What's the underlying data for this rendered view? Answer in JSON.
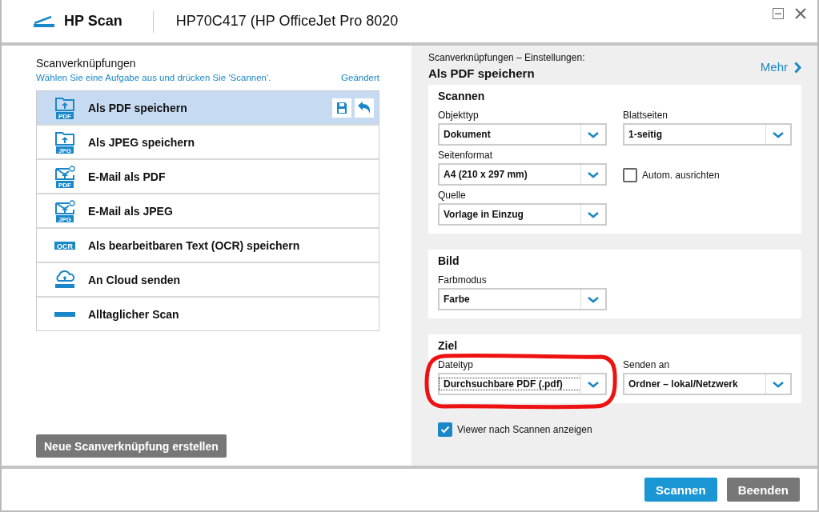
{
  "header": {
    "app_title": "HP Scan",
    "device": "HP70C417 (HP OfficeJet Pro 8020"
  },
  "shortcuts_panel": {
    "title": "Scanverknüpfungen",
    "hint": "Wählen Sie eine Aufgabe aus und drücken Sie 'Scannen'.",
    "changed_link": "Geändert",
    "items": [
      {
        "label": "Als PDF speichern",
        "kind": "folder",
        "badge": "PDF",
        "selected": true
      },
      {
        "label": "Als JPEG speichern",
        "kind": "folder",
        "badge": "JPG",
        "selected": false
      },
      {
        "label": "E-Mail als PDF",
        "kind": "mail",
        "badge": "PDF",
        "selected": false
      },
      {
        "label": "E-Mail als JPEG",
        "kind": "mail",
        "badge": "JPG",
        "selected": false
      },
      {
        "label": "Als bearbeitbaren Text (OCR) speichern",
        "kind": "ocr",
        "badge": "OCR",
        "selected": false
      },
      {
        "label": "An Cloud senden",
        "kind": "cloud",
        "selected": false
      },
      {
        "label": "Alltaglicher Scan",
        "kind": "scanner",
        "selected": false
      }
    ],
    "new_button": "Neue Scanverknüpfung erstellen"
  },
  "settings": {
    "caption": "Scanverknüpfungen – Einstellungen:",
    "name": "Als PDF speichern",
    "more_link": "Mehr",
    "sections": [
      {
        "title": "Scannen",
        "rows": [
          [
            {
              "kind": "dropdown",
              "label": "Objekttyp",
              "value": "Dokument",
              "highlighted": false
            },
            {
              "kind": "dropdown",
              "label": "Blattseiten",
              "value": "1-seitig",
              "highlighted": false
            }
          ],
          [
            {
              "kind": "dropdown",
              "label": "Seitenformat",
              "value": "A4 (210 x 297 mm)",
              "highlighted": false
            },
            {
              "kind": "checkbox",
              "label": "Autom. ausrichten",
              "checked": false
            }
          ],
          [
            {
              "kind": "dropdown",
              "label": "Quelle",
              "value": "Vorlage in Einzug",
              "highlighted": false
            }
          ]
        ]
      },
      {
        "title": "Bild",
        "rows": [
          [
            {
              "kind": "dropdown",
              "label": "Farbmodus",
              "value": "Farbe",
              "highlighted": false
            }
          ]
        ]
      },
      {
        "title": "Ziel",
        "rows": [
          [
            {
              "kind": "dropdown",
              "label": "Dateityp",
              "value": "Durchsuchbare PDF (.pdf)",
              "highlighted": true
            },
            {
              "kind": "dropdown",
              "label": "Senden an",
              "value": "Ordner – lokal/Netzwerk",
              "highlighted": false
            }
          ]
        ]
      }
    ],
    "viewer_checkbox": {
      "label": "Viewer nach Scannen anzeigen",
      "checked": true
    }
  },
  "footer_buttons": [
    {
      "label": "Scannen",
      "kind": "primary"
    },
    {
      "label": "Beenden",
      "kind": "secondary"
    }
  ]
}
